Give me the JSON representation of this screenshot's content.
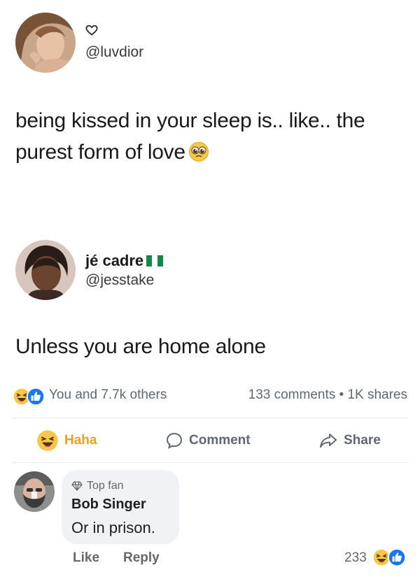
{
  "tweet1": {
    "handle": "@luvdior",
    "text": "being kissed in your sleep is.. like.. the purest form of love",
    "emoji": "pleading-face-emoji"
  },
  "tweet2": {
    "name": "jé cadre",
    "flag": "nigeria-flag-icon",
    "handle": "@jesstake",
    "text": "Unless you are home alone"
  },
  "facebook": {
    "reactions_text": "You and 7.7k others",
    "stats": "133 comments • 1K shares",
    "actions": {
      "haha": "Haha",
      "comment": "Comment",
      "share": "Share"
    },
    "colors": {
      "haha": "#e8a21d",
      "like_blue": "#1877f2",
      "muted": "#606770"
    }
  },
  "comment": {
    "badge": "Top fan",
    "name": "Bob Singer",
    "text": "Or in prison.",
    "like": "Like",
    "reply": "Reply",
    "reaction_count": "233"
  }
}
